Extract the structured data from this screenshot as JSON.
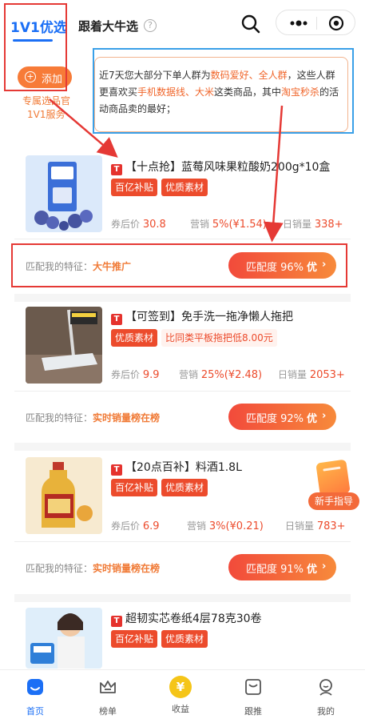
{
  "header": {
    "tab_active": "1V1优选",
    "tab_other": "跟着大牛选",
    "help_glyph": "?"
  },
  "subscribe": {
    "add_label": "添加",
    "line1": "专属选品官",
    "line2": "1V1服务"
  },
  "insight": {
    "p1": "近7天您大部分下单人群为",
    "h1": "数码爱好、全人群",
    "p2": "，这些人群更喜欢买",
    "h2": "手机数据线、大米",
    "p3": "这类商品，其中",
    "h3": "淘宝秒杀",
    "p4": "的活动商品卖的最好；"
  },
  "products": [
    {
      "badge": "T",
      "title": "【十点抢】蓝莓风味果粒酸奶200g*10盒",
      "tags": [
        {
          "text": "百亿补贴",
          "style": "solid"
        },
        {
          "text": "优质素材",
          "style": "solid"
        }
      ],
      "price_label": "券后价",
      "price": "30.8",
      "comm_label": "营销",
      "comm": "5%(¥1.54)",
      "sales_label": "日销量",
      "sales": "338+",
      "feature_label": "匹配我的特征：",
      "feature": "大牛推广",
      "match_label": "匹配度 96%",
      "match_tag": "优",
      "match_chev": "›"
    },
    {
      "badge": "T",
      "title": "【可签到】免手洗一拖净懒人拖把",
      "tags": [
        {
          "text": "优质素材",
          "style": "solid"
        },
        {
          "text": "比同类平板拖把低8.00元",
          "style": "outline"
        }
      ],
      "price_label": "券后价",
      "price": "9.9",
      "comm_label": "营销",
      "comm": "25%(¥2.48)",
      "sales_label": "日销量",
      "sales": "2053+",
      "feature_label": "匹配我的特征：",
      "feature": "实时销量榜在榜",
      "match_label": "匹配度 92%",
      "match_tag": "优",
      "match_chev": "›"
    },
    {
      "badge": "T",
      "title": "【20点百补】料酒1.8L",
      "tags": [
        {
          "text": "百亿补贴",
          "style": "solid"
        },
        {
          "text": "优质素材",
          "style": "solid"
        }
      ],
      "price_label": "券后价",
      "price": "6.9",
      "comm_label": "营销",
      "comm": "3%(¥0.21)",
      "sales_label": "日销量",
      "sales": "783+",
      "feature_label": "匹配我的特征：",
      "feature": "实时销量榜在榜",
      "match_label": "匹配度 91%",
      "match_tag": "优",
      "match_chev": "›"
    },
    {
      "badge": "T",
      "title": "超韧实芯卷纸4层78克30卷",
      "tags": [
        {
          "text": "百亿补贴",
          "style": "solid"
        },
        {
          "text": "优质素材",
          "style": "solid"
        }
      ]
    }
  ],
  "guide": {
    "label": "新手指导"
  },
  "tabbar": {
    "items": [
      {
        "label": "首页",
        "icon": "home-icon"
      },
      {
        "label": "榜单",
        "icon": "crown-icon"
      },
      {
        "label": "收益",
        "icon": "yen-coin-icon",
        "glyph": "¥"
      },
      {
        "label": "跟推",
        "icon": "inbox-icon"
      },
      {
        "label": "我的",
        "icon": "profile-icon"
      }
    ]
  },
  "colors": {
    "brand_blue": "#1b6ff5",
    "accent_orange": "#f07a36",
    "price_red": "#ec4b2c",
    "annotation_red": "#e53935",
    "annotation_blue": "#3aa0e8"
  }
}
